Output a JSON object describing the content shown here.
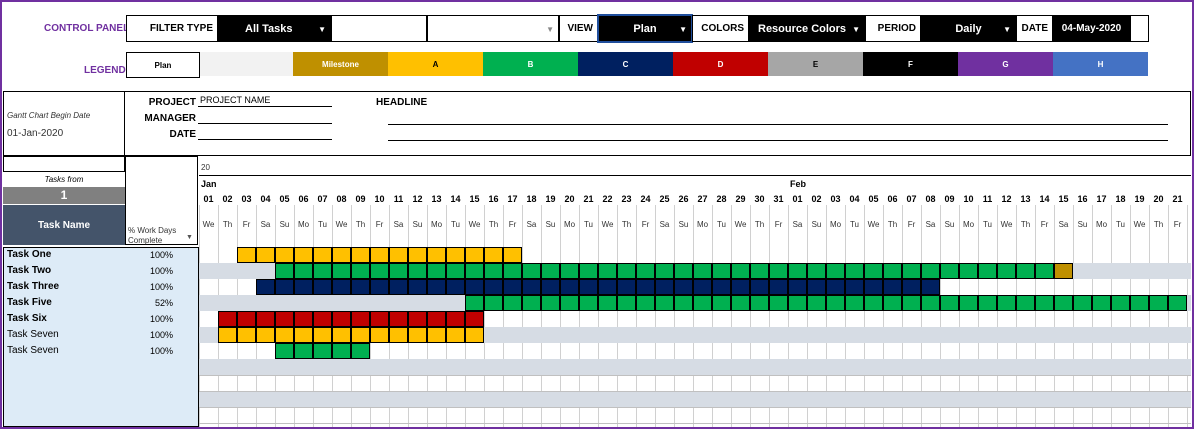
{
  "control_panel": {
    "label": "CONTROL PANEL",
    "filter_type_label": "FILTER TYPE",
    "filter_type_value": "All Tasks",
    "view_label": "VIEW",
    "view_value": "Plan",
    "colors_label": "COLORS",
    "colors_value": "Resource Colors",
    "period_label": "PERIOD",
    "period_value": "Daily",
    "date_label": "DATE",
    "date_value": "04-May-2020"
  },
  "legend": {
    "label": "LEGEND",
    "plan": "Plan",
    "items": [
      {
        "label": "",
        "color": "#f2f2f2"
      },
      {
        "label": "Milestone",
        "color": "#bf9000",
        "text_color": "#ffffff"
      },
      {
        "label": "A",
        "color": "#ffc000",
        "text_color": "#000000"
      },
      {
        "label": "B",
        "color": "#00b050",
        "text_color": "#ffffff"
      },
      {
        "label": "C",
        "color": "#002060",
        "text_color": "#ffffff"
      },
      {
        "label": "D",
        "color": "#c00000",
        "text_color": "#ffffff"
      },
      {
        "label": "E",
        "color": "#a6a6a6",
        "text_color": "#000000"
      },
      {
        "label": "F",
        "color": "#000000",
        "text_color": "#ffffff"
      },
      {
        "label": "G",
        "color": "#7030a0",
        "text_color": "#ffffff"
      },
      {
        "label": "H",
        "color": "#4472c4",
        "text_color": "#ffffff"
      }
    ]
  },
  "project": {
    "gantt_begin_label": "Gantt Chart Begin Date",
    "gantt_begin_value": "01-Jan-2020",
    "project_label": "PROJECT",
    "project_value": "PROJECT NAME",
    "manager_label": "MANAGER",
    "date_label": "DATE",
    "headline_label": "HEADLINE"
  },
  "task_panel": {
    "tasks_from_label": "Tasks from",
    "tasks_from_value": "1",
    "task_name_header": "Task Name",
    "pct_header_line1": "% Work Days",
    "pct_header_line2": "Complete"
  },
  "tasks": [
    {
      "name": "Task One",
      "bold": true,
      "pct": "100%",
      "start": 2,
      "end": 16,
      "color": "#ffc000",
      "band": false
    },
    {
      "name": "Task Two",
      "bold": true,
      "pct": "100%",
      "start": 4,
      "end": 45,
      "color": "#00b050",
      "band": true,
      "milestone": 45
    },
    {
      "name": "Task Three",
      "bold": true,
      "pct": "100%",
      "start": 3,
      "end": 38,
      "color": "#002060",
      "band": false
    },
    {
      "name": "Task Five",
      "bold": true,
      "pct": "52%",
      "start": 14,
      "end": 51,
      "color": "#00b050",
      "band": true
    },
    {
      "name": "Task Six",
      "bold": true,
      "pct": "100%",
      "start": 1,
      "end": 14,
      "color": "#c00000",
      "band": false
    },
    {
      "name": "Task Seven",
      "bold": false,
      "pct": "100%",
      "start": 1,
      "end": 14,
      "color": "#ffc000",
      "band": true
    },
    {
      "name": "Task Seven",
      "bold": false,
      "pct": "100%",
      "start": 4,
      "end": 8,
      "color": "#00b050",
      "band": false
    }
  ],
  "calendar": {
    "year": "20",
    "months": [
      {
        "label": "Jan",
        "col": 0
      },
      {
        "label": "Feb",
        "col": 31
      }
    ],
    "days": [
      "01",
      "02",
      "03",
      "04",
      "05",
      "06",
      "07",
      "08",
      "09",
      "10",
      "11",
      "12",
      "13",
      "14",
      "15",
      "16",
      "17",
      "18",
      "19",
      "20",
      "21",
      "22",
      "23",
      "24",
      "25",
      "26",
      "27",
      "28",
      "29",
      "30",
      "31",
      "01",
      "02",
      "03",
      "04",
      "05",
      "06",
      "07",
      "08",
      "09",
      "10",
      "11",
      "12",
      "13",
      "14",
      "15",
      "16",
      "17",
      "18",
      "19",
      "20",
      "21"
    ],
    "weekdays": [
      "We",
      "Th",
      "Fr",
      "Sa",
      "Su",
      "Mo",
      "Tu",
      "We",
      "Th",
      "Fr",
      "Sa",
      "Su",
      "Mo",
      "Tu",
      "We",
      "Th",
      "Fr",
      "Sa",
      "Su",
      "Mo",
      "Tu",
      "We",
      "Th",
      "Fr",
      "Sa",
      "Su",
      "Mo",
      "Tu",
      "We",
      "Th",
      "Fr",
      "Sa",
      "Su",
      "Mo",
      "Tu",
      "We",
      "Th",
      "Fr",
      "Sa",
      "Su",
      "Mo",
      "Tu",
      "We",
      "Th",
      "Fr",
      "Sa",
      "Su",
      "Mo",
      "Tu",
      "We",
      "Th",
      "Fr"
    ]
  }
}
